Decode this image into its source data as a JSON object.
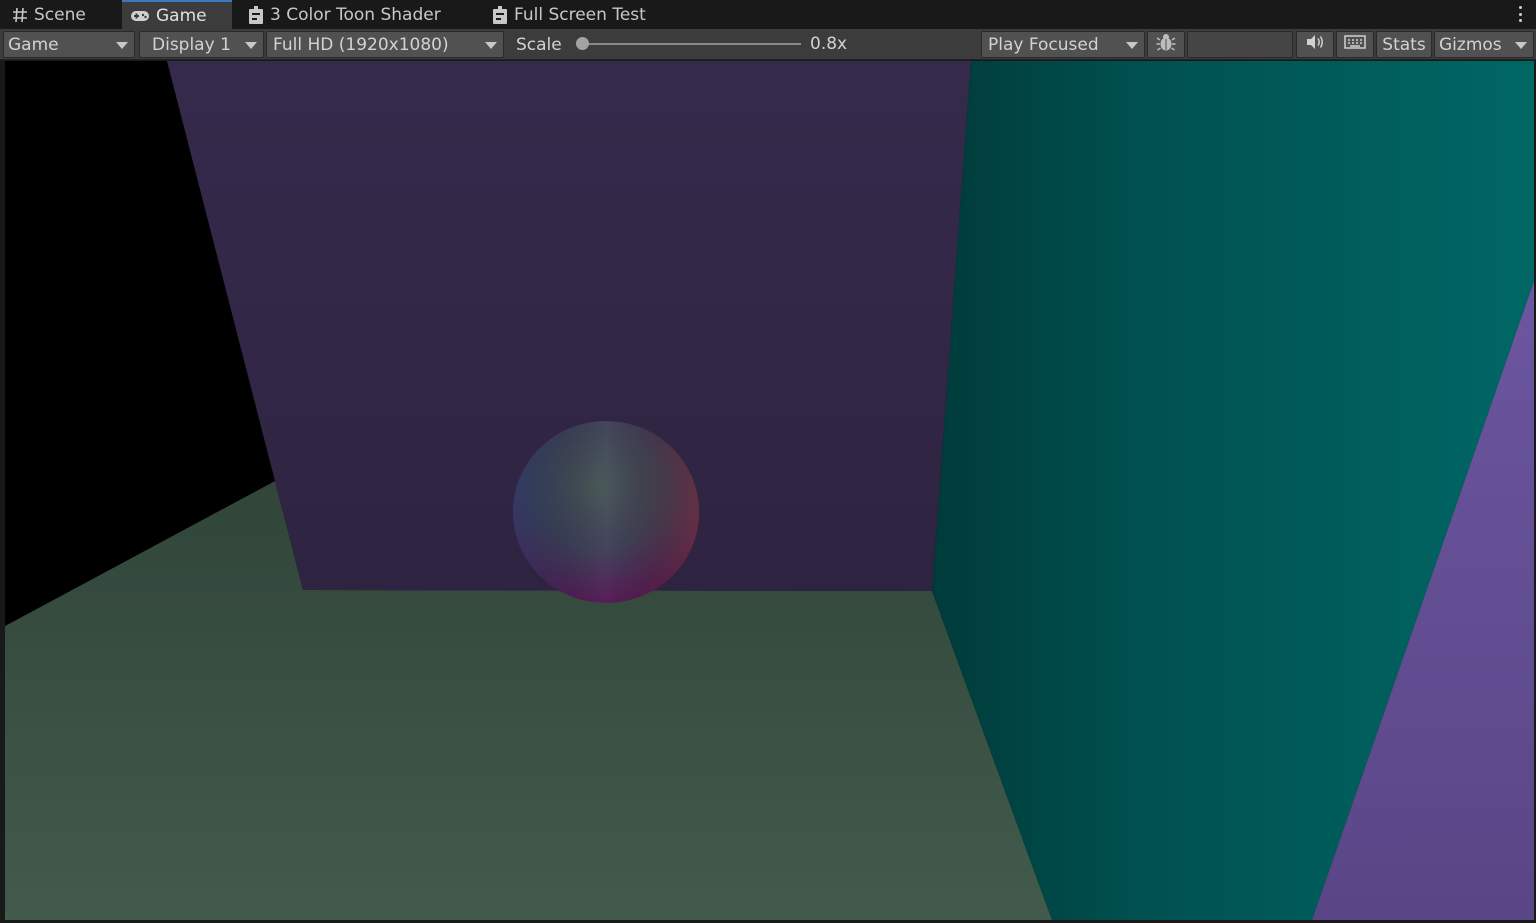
{
  "tabs": [
    {
      "label": "Scene",
      "icon": "hash-icon",
      "active": false
    },
    {
      "label": "Game",
      "icon": "gamepad-icon",
      "active": true
    },
    {
      "label": "3 Color Toon Shader",
      "icon": "timeline-icon",
      "active": false
    },
    {
      "label": "Full Screen Test",
      "icon": "timeline-icon",
      "active": false
    }
  ],
  "toolbar": {
    "view_select": "Game",
    "display_select": "Display 1",
    "resolution_select": "Full HD (1920x1080)",
    "scale_label": "Scale",
    "scale_value": "0.8x",
    "play_mode_select": "Play Focused",
    "stats_label": "Stats",
    "gizmos_label": "Gizmos"
  },
  "colors": {
    "tab_active_accent": "#3a79bb",
    "back_wall": "#322748",
    "floor": "#3d5548",
    "right_wall": "#005e5c",
    "purple_wall": "#634f8d"
  }
}
